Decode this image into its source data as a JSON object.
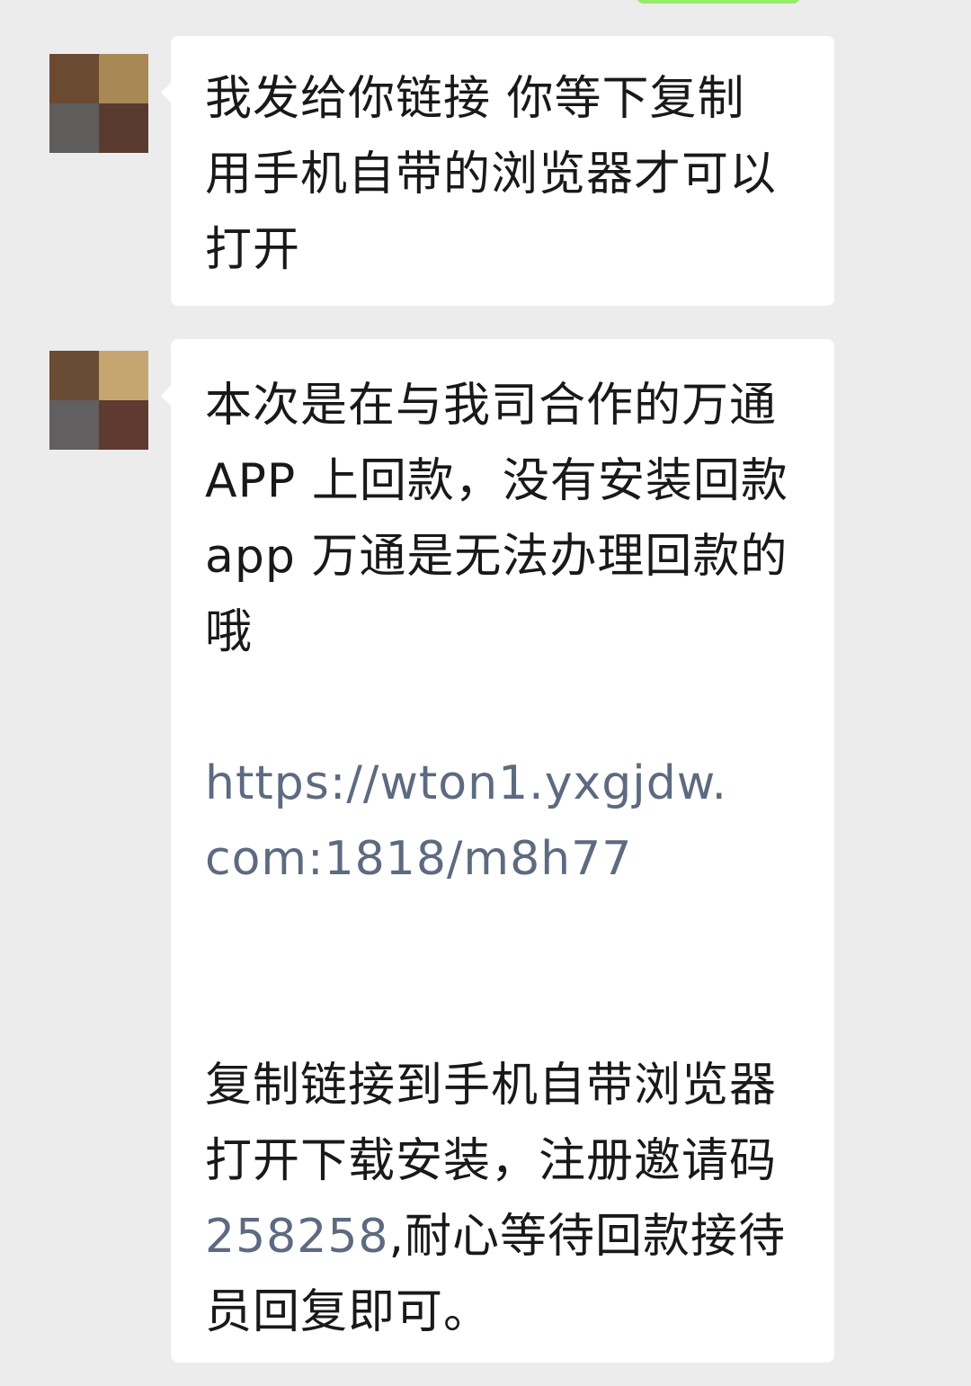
{
  "colors": {
    "background": "#ececec",
    "bubble": "#ffffff",
    "text": "#191919",
    "link": "#5d6a80",
    "outgoing_bubble": "#95ec69"
  },
  "messages": [
    {
      "sender": "contact",
      "avatar": "blurred-avatar",
      "lines": [
        "我发给你链接 你等下复制",
        "用手机自带的浏览器才可以",
        "打开"
      ]
    },
    {
      "sender": "contact",
      "avatar": "blurred-avatar",
      "paragraph1": [
        "本次是在与我司合作的万通",
        "APP 上回款，没有安装回款",
        "app 万通是无法办理回款的",
        "哦"
      ],
      "link": [
        "https://wton1.yxgjdw.",
        "com:1818/m8h77"
      ],
      "paragraph2": {
        "line1": "复制链接到手机自带浏览器",
        "line2": "打开下载安装，注册邀请码",
        "code": "258258",
        "line3_rest": ",耐心等待回款接待",
        "line4": "员回复即可。"
      }
    }
  ]
}
